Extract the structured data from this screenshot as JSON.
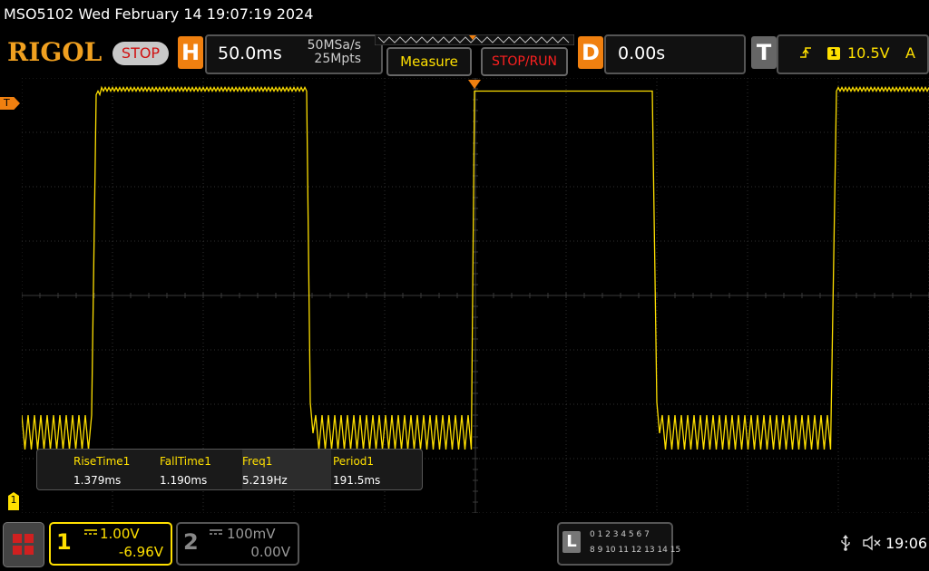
{
  "titlebar": {
    "text": "MSO5102  Wed February 14 19:07:19 2024"
  },
  "toolbar": {
    "logo": "RIGOL",
    "status": "STOP",
    "horizontal": {
      "letter": "H",
      "timebase": "50.0ms",
      "sample_rate": "50MSa/s",
      "memory_depth": "25Mpts"
    },
    "measure_label": "Measure",
    "stoprun_label": "STOP/RUN",
    "delay": {
      "letter": "D",
      "value": "0.00s"
    },
    "trigger": {
      "letter": "T",
      "source": "1",
      "level": "10.5V",
      "mode": "A"
    }
  },
  "markers": {
    "trigger_left": "T",
    "channel1": "1"
  },
  "measurements": [
    {
      "name": "RiseTime1",
      "value": "1.379ms"
    },
    {
      "name": "FallTime1",
      "value": "1.190ms"
    },
    {
      "name": "Freq1",
      "value": "5.219Hz"
    },
    {
      "name": "Period1",
      "value": "191.5ms"
    }
  ],
  "channels": {
    "ch1": {
      "number": "1",
      "scale": "1.00V",
      "offset": "-6.96V",
      "color": "#ffe000"
    },
    "ch2": {
      "number": "2",
      "scale": "100mV",
      "offset": "0.00V",
      "color": "#888888"
    }
  },
  "logic": {
    "letter": "L",
    "row1": "0 1 2 3   4 5 6 7",
    "row2": "8  9 10 11  12 13 14 15"
  },
  "clock": "19:06",
  "colors": {
    "accent": "#f08010",
    "trace": "#ffe000",
    "stop": "#d01010"
  }
}
